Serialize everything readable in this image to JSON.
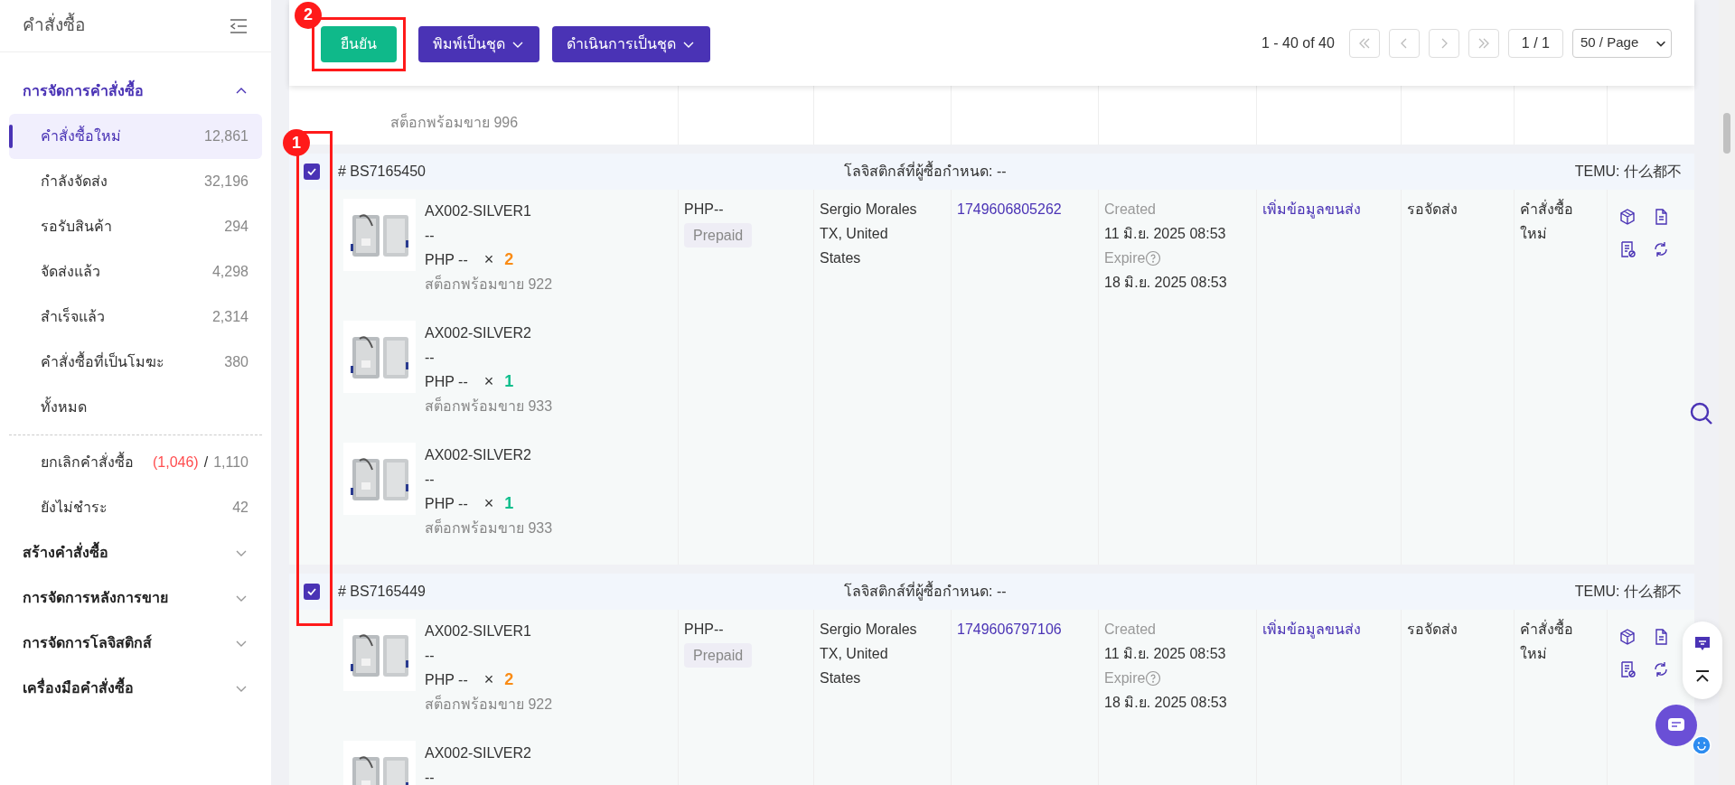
{
  "sidebar": {
    "title": "คำสั่งซื้อ",
    "sections": [
      {
        "label": "การจัดการคำสั่งซื้อ",
        "expanded": true,
        "items": [
          {
            "label": "คำสั่งซื้อใหม่",
            "count": "12,861",
            "selected": true
          },
          {
            "label": "กำลังจัดส่ง",
            "count": "32,196",
            "selected": false
          },
          {
            "label": "รอรับสินค้า",
            "count": "294",
            "selected": false
          },
          {
            "label": "จัดส่งแล้ว",
            "count": "4,298",
            "selected": false
          },
          {
            "label": "สำเร็จแล้ว",
            "count": "2,314",
            "selected": false
          },
          {
            "label": "คำสั่งซื้อที่เป็นโมฆะ",
            "count": "380",
            "selected": false
          },
          {
            "label": "ทั้งหมด",
            "selected": false
          }
        ],
        "items_after_divider": [
          {
            "label": "ยกเลิกคำสั่งซื้อ",
            "alert_count": "(1,046)",
            "separator": "/",
            "count": "1,110",
            "selected": false
          },
          {
            "label": "ยังไม่ชำระ",
            "count": "42",
            "selected": false
          }
        ]
      },
      {
        "label": "สร้างคำสั่งซื้อ",
        "expanded": false
      },
      {
        "label": "การจัดการหลังการขาย",
        "expanded": false
      },
      {
        "label": "การจัดการโลจิสติกส์",
        "expanded": false
      },
      {
        "label": "เครื่องมือคำสั่งซื้อ",
        "expanded": false
      }
    ]
  },
  "toolbar": {
    "buttons": [
      {
        "label": "ยืนยัน",
        "kind": "primary"
      },
      {
        "label": "พิมพ์เป็นชุด",
        "kind": "dropdown"
      },
      {
        "label": "ดำเนินการเป็นชุด",
        "kind": "dropdown"
      }
    ],
    "pagination": {
      "range": "1 - 40 of 40",
      "page": "1 / 1",
      "page_size": "50 / Page"
    }
  },
  "partial_row": {
    "stock": "สต็อกพร้อมขาย 996"
  },
  "orders": [
    {
      "checked": true,
      "number": "# BS7165450",
      "logistics_note": "โลจิสติกส์ที่ผู้ซื้อกำหนด: --",
      "platform": "TEMU: 什么都不",
      "items": [
        {
          "sku": "AX002-SILVER1",
          "variant": "--",
          "price": "PHP --",
          "times": "×",
          "qty": "2",
          "color": "#fa8c16",
          "stock": "สต็อกพร้อมขาย 922"
        },
        {
          "sku": "AX002-SILVER2",
          "variant": "--",
          "price": "PHP --",
          "times": "×",
          "qty": "1",
          "color": "#0fbe8c",
          "stock": "สต็อกพร้อมขาย 933"
        },
        {
          "sku": "AX002-SILVER2",
          "variant": "--",
          "price": "PHP --",
          "times": "×",
          "qty": "1",
          "color": "#0fbe8c",
          "stock": "สต็อกพร้อมขาย 933"
        }
      ],
      "amount": "PHP--",
      "payment": "Prepaid",
      "buyer": "Sergio Morales TX, United States",
      "order_id": "1749606805262",
      "created_label": "Created",
      "created": "11 มิ.ย. 2025 08:53",
      "expire_label": "Expire",
      "expire": "18 มิ.ย. 2025 08:53",
      "logistics": "เพิ่มข้อมูลขนส่ง",
      "status": "รอจัดส่ง",
      "order_status": "คำสั่งซื้อใหม่"
    },
    {
      "checked": true,
      "number": "# BS7165449",
      "logistics_note": "โลจิสติกส์ที่ผู้ซื้อกำหนด: --",
      "platform": "TEMU: 什么都不",
      "items": [
        {
          "sku": "AX002-SILVER1",
          "variant": "--",
          "price": "PHP --",
          "times": "×",
          "qty": "2",
          "color": "#fa8c16",
          "stock": "สต็อกพร้อมขาย 922"
        },
        {
          "sku": "AX002-SILVER2",
          "variant": "--"
        }
      ],
      "amount": "PHP--",
      "payment": "Prepaid",
      "buyer": "Sergio Morales TX, United States",
      "order_id": "1749606797106",
      "created_label": "Created",
      "created": "11 มิ.ย. 2025 08:53",
      "expire_label": "Expire",
      "expire": "18 มิ.ย. 2025 08:53",
      "logistics": "เพิ่มข้อมูลขนส่ง",
      "status": "รอจัดส่ง",
      "order_status": "คำสั่งซื้อใหม่"
    }
  ],
  "annotations": [
    {
      "label": "1",
      "kind": "checkboxes"
    },
    {
      "label": "2",
      "kind": "confirm"
    }
  ]
}
